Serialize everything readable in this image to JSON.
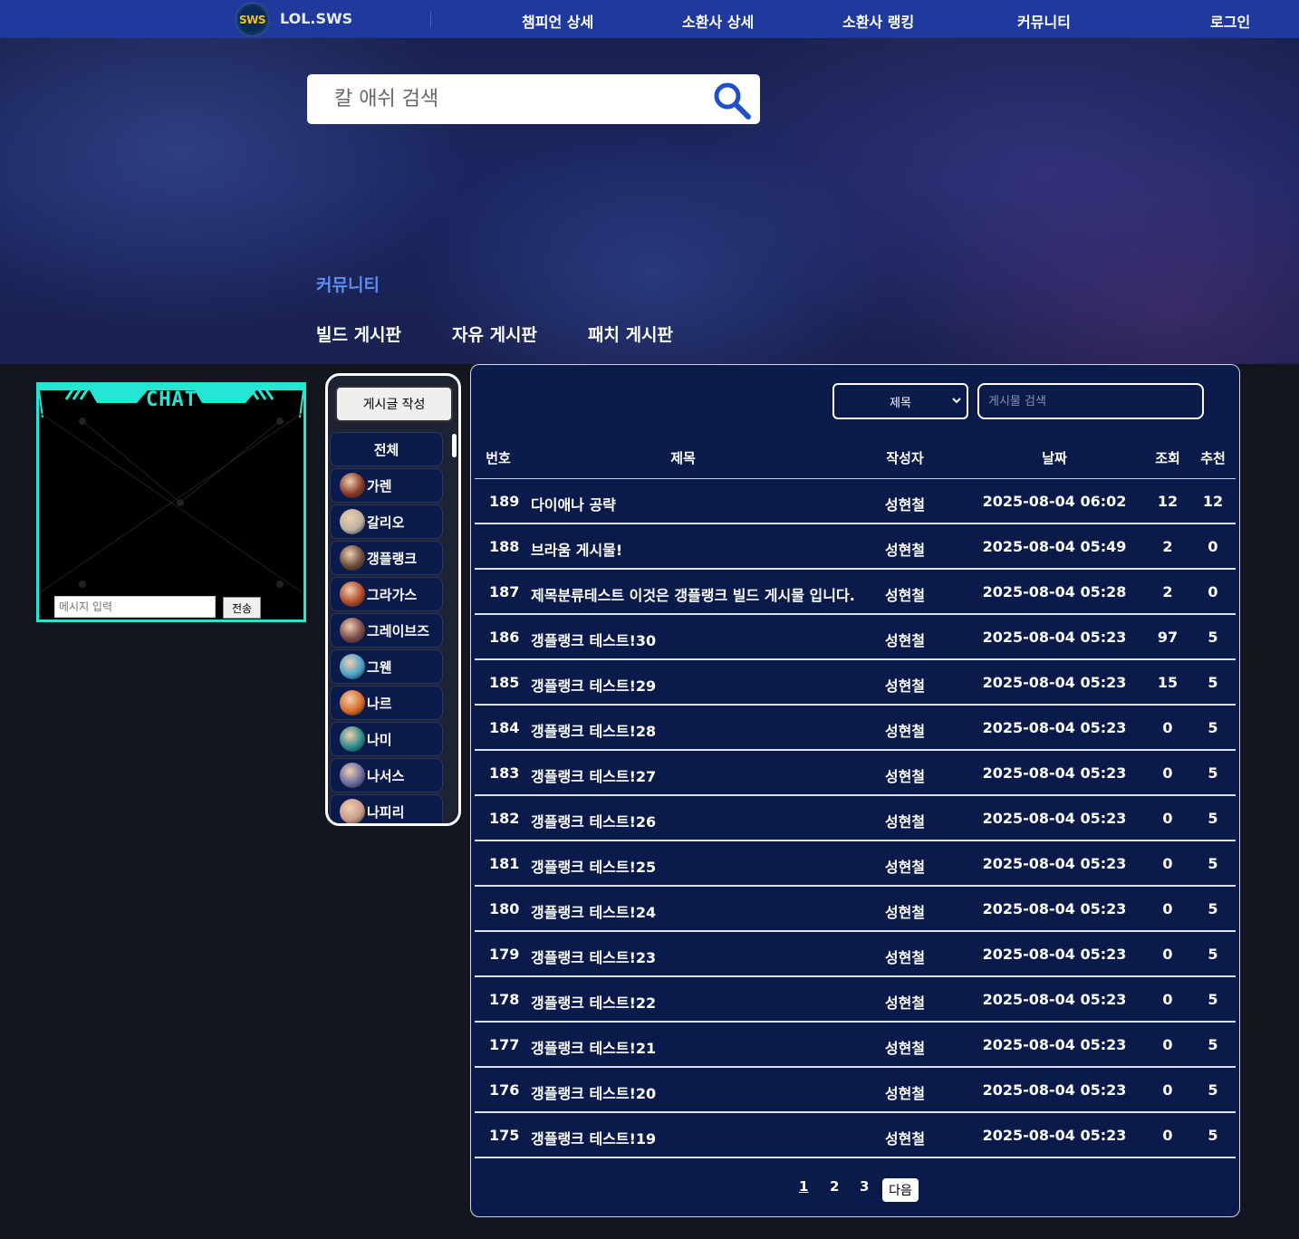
{
  "nav": {
    "logo_badge": "SWS",
    "site_name": "LOL.SWS",
    "links": [
      "챔피언 상세",
      "소환사 상세",
      "소환사 랭킹",
      "커뮤니티"
    ],
    "login": "로그인"
  },
  "hero": {
    "search_placeholder": "칼 애쉬 검색",
    "title": "커뮤니티",
    "boards": [
      "빌드 게시판",
      "자유 게시판",
      "패치 게시판"
    ]
  },
  "chat": {
    "title": "CHAT",
    "input_placeholder": "메시지 입력",
    "send_label": "전송"
  },
  "champions": {
    "write_button": "게시글 작성",
    "all_label": "전체",
    "items": [
      {
        "name": "가렌",
        "color": "#8a3a2a"
      },
      {
        "name": "갈리오",
        "color": "#b8b0a0"
      },
      {
        "name": "갱플랭크",
        "color": "#6a4a3a"
      },
      {
        "name": "그라가스",
        "color": "#b04a2a"
      },
      {
        "name": "그레이브즈",
        "color": "#7a4a4a"
      },
      {
        "name": "그웬",
        "color": "#4aa0c8"
      },
      {
        "name": "나르",
        "color": "#d86a2a"
      },
      {
        "name": "나미",
        "color": "#2a8a8a"
      },
      {
        "name": "나서스",
        "color": "#6a6aa0"
      },
      {
        "name": "나피리",
        "color": "#c89a8a"
      }
    ]
  },
  "board": {
    "filter_selected": "제목",
    "search_placeholder": "게시물 검색",
    "columns": [
      "번호",
      "제목",
      "작성자",
      "날짜",
      "조회",
      "추천"
    ],
    "rows": [
      {
        "no": "189",
        "title": "다이애나 공략",
        "author": "성현철",
        "date": "2025-08-04 06:02",
        "views": "12",
        "likes": "12"
      },
      {
        "no": "188",
        "title": "브라움 게시물!",
        "author": "성현철",
        "date": "2025-08-04 05:49",
        "views": "2",
        "likes": "0"
      },
      {
        "no": "187",
        "title": "제목분류테스트 이것은 갱플랭크 빌드 게시물 입니다.",
        "author": "성현철",
        "date": "2025-08-04 05:28",
        "views": "2",
        "likes": "0"
      },
      {
        "no": "186",
        "title": "갱플랭크 테스트!30",
        "author": "성현철",
        "date": "2025-08-04 05:23",
        "views": "97",
        "likes": "5"
      },
      {
        "no": "185",
        "title": "갱플랭크 테스트!29",
        "author": "성현철",
        "date": "2025-08-04 05:23",
        "views": "15",
        "likes": "5"
      },
      {
        "no": "184",
        "title": "갱플랭크 테스트!28",
        "author": "성현철",
        "date": "2025-08-04 05:23",
        "views": "0",
        "likes": "5"
      },
      {
        "no": "183",
        "title": "갱플랭크 테스트!27",
        "author": "성현철",
        "date": "2025-08-04 05:23",
        "views": "0",
        "likes": "5"
      },
      {
        "no": "182",
        "title": "갱플랭크 테스트!26",
        "author": "성현철",
        "date": "2025-08-04 05:23",
        "views": "0",
        "likes": "5"
      },
      {
        "no": "181",
        "title": "갱플랭크 테스트!25",
        "author": "성현철",
        "date": "2025-08-04 05:23",
        "views": "0",
        "likes": "5"
      },
      {
        "no": "180",
        "title": "갱플랭크 테스트!24",
        "author": "성현철",
        "date": "2025-08-04 05:23",
        "views": "0",
        "likes": "5"
      },
      {
        "no": "179",
        "title": "갱플랭크 테스트!23",
        "author": "성현철",
        "date": "2025-08-04 05:23",
        "views": "0",
        "likes": "5"
      },
      {
        "no": "178",
        "title": "갱플랭크 테스트!22",
        "author": "성현철",
        "date": "2025-08-04 05:23",
        "views": "0",
        "likes": "5"
      },
      {
        "no": "177",
        "title": "갱플랭크 테스트!21",
        "author": "성현철",
        "date": "2025-08-04 05:23",
        "views": "0",
        "likes": "5"
      },
      {
        "no": "176",
        "title": "갱플랭크 테스트!20",
        "author": "성현철",
        "date": "2025-08-04 05:23",
        "views": "0",
        "likes": "5"
      },
      {
        "no": "175",
        "title": "갱플랭크 테스트!19",
        "author": "성현철",
        "date": "2025-08-04 05:23",
        "views": "0",
        "likes": "5"
      }
    ],
    "pages": [
      "1",
      "2",
      "3"
    ],
    "next_label": "다음"
  },
  "colors": {
    "nav_bg": "#1f3a9c",
    "panel_bg": "#0a1a4a",
    "chat_accent": "#25e6d2",
    "hero_title": "#5c8df0"
  }
}
